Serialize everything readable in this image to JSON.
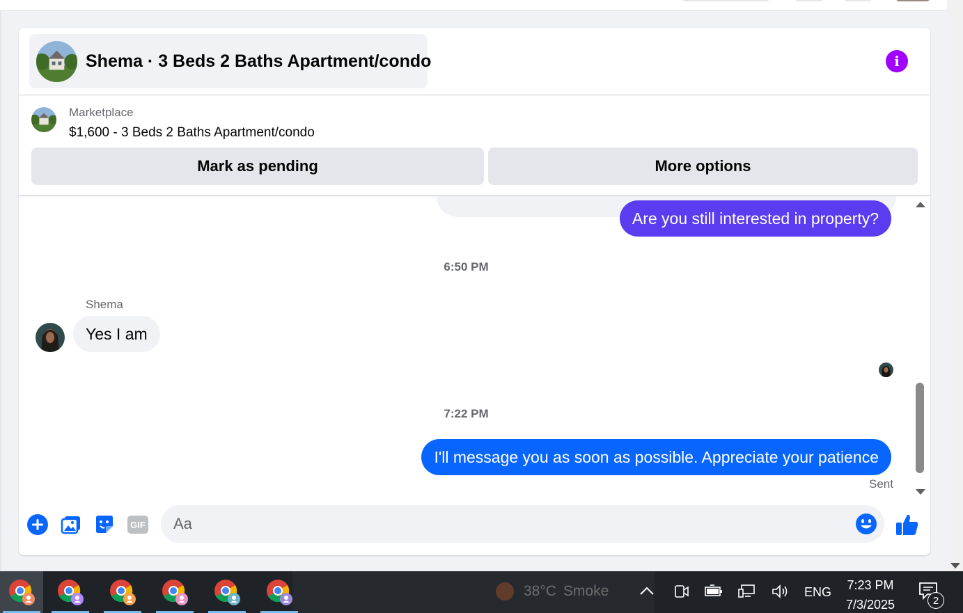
{
  "conversation": {
    "title": "Shema · 3 Beds 2 Baths Apartment/condo",
    "accent_color": "#a100ff"
  },
  "listing": {
    "source_label": "Marketplace",
    "summary": "$1,600 - 3 Beds 2 Baths Apartment/condo",
    "mark_pending_label": "Mark as pending",
    "more_options_label": "More options"
  },
  "messages": [
    {
      "from": "me",
      "text": "Are you still interested in property?",
      "color": "#5b3cf0"
    },
    {
      "type": "timestamp",
      "text": "6:50 PM"
    },
    {
      "from": "Shema",
      "sender_label": "Shema",
      "text": "Yes I am"
    },
    {
      "type": "timestamp",
      "text": "7:22 PM"
    },
    {
      "from": "me",
      "text": "I'll message you as soon as possible. Appreciate your patience",
      "color": "#0866ff",
      "status": "Sent"
    }
  ],
  "composer": {
    "placeholder": "Aa",
    "icons": [
      "plus-icon",
      "photo-icon",
      "sticker-icon",
      "gif-icon",
      "emoji-icon",
      "thumbs-up-icon"
    ],
    "gif_label": "GIF"
  },
  "taskbar": {
    "weather": {
      "temp": "38°C",
      "condition": "Smoke"
    },
    "language": "ENG",
    "time": "7:23 PM",
    "date": "7/3/2025",
    "notification_count": "2"
  }
}
